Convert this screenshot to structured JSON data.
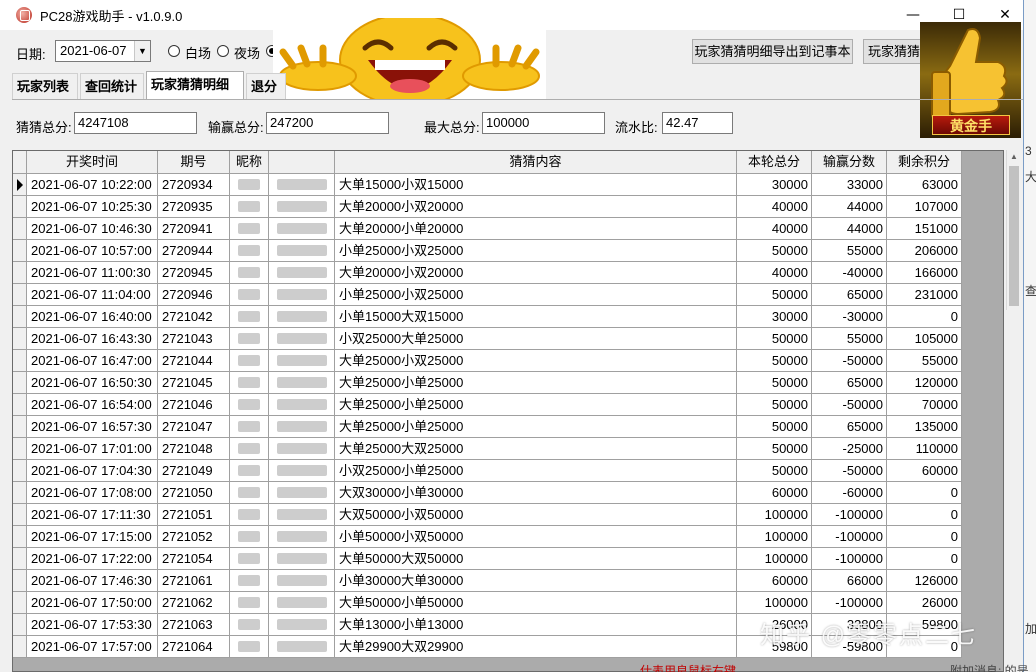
{
  "window": {
    "title": "PC28游戏助手 - v1.0.9.0",
    "minimize": "—",
    "maximize": "☐",
    "close": "✕"
  },
  "toolbar": {
    "date_label": "日期:",
    "date_value": "2021-06-07",
    "radio_day": "白场",
    "radio_night": "夜场",
    "export_button": "玩家猜猜明细导出到记事本",
    "second_button": "玩家猜猜"
  },
  "badge": {
    "label": "黄金手"
  },
  "tabs": [
    {
      "label": "玩家列表"
    },
    {
      "label": "查回统计"
    },
    {
      "label": "玩家猜猜明细"
    },
    {
      "label": "退分"
    }
  ],
  "stats": {
    "guess_total_label": "猜猜总分:",
    "guess_total": "4247108",
    "winloss_total_label": "输赢总分:",
    "winloss_total": "247200",
    "max_total_label": "最大总分:",
    "max_total": "100000",
    "flow_ratio_label": "流水比:",
    "flow_ratio": "42.47"
  },
  "table": {
    "headers": [
      "开奖时间",
      "期号",
      "昵称",
      "",
      "猜猜内容",
      "本轮总分",
      "输赢分数",
      "剩余积分"
    ],
    "rows": [
      [
        "2021-06-07 10:22:00",
        "2720934",
        "大单15000小双15000",
        "30000",
        "33000",
        "63000"
      ],
      [
        "2021-06-07 10:25:30",
        "2720935",
        "大单20000小双20000",
        "40000",
        "44000",
        "107000"
      ],
      [
        "2021-06-07 10:46:30",
        "2720941",
        "大单20000小单20000",
        "40000",
        "44000",
        "151000"
      ],
      [
        "2021-06-07 10:57:00",
        "2720944",
        "小单25000小双25000",
        "50000",
        "55000",
        "206000"
      ],
      [
        "2021-06-07 11:00:30",
        "2720945",
        "大单20000小双20000",
        "40000",
        "-40000",
        "166000"
      ],
      [
        "2021-06-07 11:04:00",
        "2720946",
        "小单25000小双25000",
        "50000",
        "65000",
        "231000"
      ],
      [
        "2021-06-07 16:40:00",
        "2721042",
        "小单15000大双15000",
        "30000",
        "-30000",
        "0"
      ],
      [
        "2021-06-07 16:43:30",
        "2721043",
        "小双25000大单25000",
        "50000",
        "55000",
        "105000"
      ],
      [
        "2021-06-07 16:47:00",
        "2721044",
        "大单25000小双25000",
        "50000",
        "-50000",
        "55000"
      ],
      [
        "2021-06-07 16:50:30",
        "2721045",
        "大单25000小单25000",
        "50000",
        "65000",
        "120000"
      ],
      [
        "2021-06-07 16:54:00",
        "2721046",
        "大单25000小单25000",
        "50000",
        "-50000",
        "70000"
      ],
      [
        "2021-06-07 16:57:30",
        "2721047",
        "大单25000小单25000",
        "50000",
        "65000",
        "135000"
      ],
      [
        "2021-06-07 17:01:00",
        "2721048",
        "大单25000大双25000",
        "50000",
        "-25000",
        "110000"
      ],
      [
        "2021-06-07 17:04:30",
        "2721049",
        "小双25000小单25000",
        "50000",
        "-50000",
        "60000"
      ],
      [
        "2021-06-07 17:08:00",
        "2721050",
        "大双30000小单30000",
        "60000",
        "-60000",
        "0"
      ],
      [
        "2021-06-07 17:11:30",
        "2721051",
        "大双50000小双50000",
        "100000",
        "-100000",
        "0"
      ],
      [
        "2021-06-07 17:15:00",
        "2721052",
        "小单50000小双50000",
        "100000",
        "-100000",
        "0"
      ],
      [
        "2021-06-07 17:22:00",
        "2721054",
        "大单50000大双50000",
        "100000",
        "-100000",
        "0"
      ],
      [
        "2021-06-07 17:46:30",
        "2721061",
        "小单30000大单30000",
        "60000",
        "66000",
        "126000"
      ],
      [
        "2021-06-07 17:50:00",
        "2721062",
        "大单50000小单50000",
        "100000",
        "-100000",
        "26000"
      ],
      [
        "2021-06-07 17:53:30",
        "2721063",
        "大单13000小单13000",
        "26000",
        "33800",
        "59800"
      ],
      [
        "2021-06-07 17:57:00",
        "2721064",
        "大单29900大双29900",
        "59800",
        "-59800",
        "0"
      ]
    ]
  },
  "side_strip": {
    "chars": [
      "3",
      "大",
      "查",
      "加"
    ]
  },
  "watermark": "知乎 @零零点二七",
  "bottom": {
    "red_text": "仕表用良鼠标右键",
    "gray_text": "附加消息: 的是"
  }
}
